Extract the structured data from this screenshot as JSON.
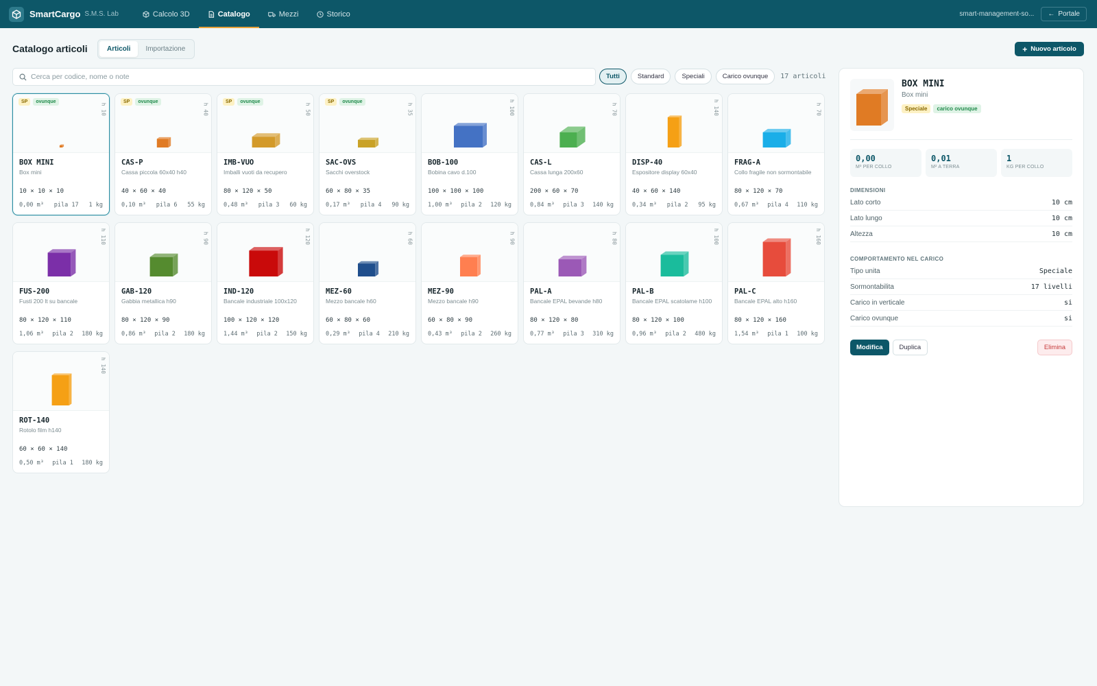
{
  "app": {
    "brand": "SmartCargo",
    "brand_sub": "S.M.S. Lab",
    "account": "smart-management-so...",
    "portal_label": "Portale",
    "accent": "#0d5768"
  },
  "nav": [
    {
      "label": "Calcolo 3D",
      "icon": "cube-icon"
    },
    {
      "label": "Catalogo",
      "icon": "document-icon",
      "active": true
    },
    {
      "label": "Mezzi",
      "icon": "truck-icon"
    },
    {
      "label": "Storico",
      "icon": "clock-icon"
    }
  ],
  "header": {
    "title": "Catalogo articoli",
    "tabs": [
      "Articoli",
      "Importazione"
    ],
    "new_button": "Nuovo articolo"
  },
  "search": {
    "placeholder": "Cerca per codice, nome o note"
  },
  "filters": {
    "chips": [
      "Tutti",
      "Standard",
      "Speciali",
      "Carico ovunque"
    ],
    "count": "17 articoli"
  },
  "tags": {
    "sp": "SP",
    "ov": "ovunque"
  },
  "items": [
    {
      "code": "BOX MINI",
      "name": "Box mini",
      "dims": "10 × 10 × 10",
      "vol": "0,00 m³",
      "pile": "pila 17",
      "weight": "1 kg",
      "h": "h 10",
      "sp": true,
      "color": "#e07b24",
      "hval": 10,
      "wval": 10,
      "lval": 10
    },
    {
      "code": "CAS-P",
      "name": "Cassa piccola 60x40 h40",
      "dims": "40 × 60 × 40",
      "vol": "0,10 m³",
      "pile": "pila 6",
      "weight": "55 kg",
      "h": "h 40",
      "sp": true,
      "color": "#e07b24",
      "hval": 40,
      "wval": 40,
      "lval": 60
    },
    {
      "code": "IMB-VUO",
      "name": "Imballi vuoti da recupero",
      "dims": "80 × 120 × 50",
      "vol": "0,48 m³",
      "pile": "pila 3",
      "weight": "60 kg",
      "h": "h 50",
      "sp": true,
      "color": "#d39a2a",
      "hval": 50,
      "wval": 80,
      "lval": 120
    },
    {
      "code": "SAC-OVS",
      "name": "Sacchi overstock",
      "dims": "60 × 80 × 35",
      "vol": "0,17 m³",
      "pile": "pila 4",
      "weight": "90 kg",
      "h": "h 35",
      "sp": true,
      "color": "#c9a227",
      "hval": 35,
      "wval": 60,
      "lval": 80
    },
    {
      "code": "BOB-100",
      "name": "Bobina cavo d.100",
      "dims": "100 × 100 × 100",
      "vol": "1,00 m³",
      "pile": "pila 2",
      "weight": "120 kg",
      "h": "h 100",
      "sp": false,
      "color": "#4472c4",
      "hval": 100,
      "wval": 100,
      "lval": 100
    },
    {
      "code": "CAS-L",
      "name": "Cassa lunga 200x60",
      "dims": "200 × 60 × 70",
      "vol": "0,84 m³",
      "pile": "pila 3",
      "weight": "140 kg",
      "h": "h 70",
      "sp": false,
      "color": "#4caf50",
      "hval": 70,
      "wval": 60,
      "lval": 200
    },
    {
      "code": "DISP-40",
      "name": "Espositore display 60x40",
      "dims": "40 × 60 × 140",
      "vol": "0,34 m³",
      "pile": "pila 2",
      "weight": "95 kg",
      "h": "h 140",
      "sp": false,
      "color": "#f5a015",
      "hval": 140,
      "wval": 40,
      "lval": 60
    },
    {
      "code": "FRAG-A",
      "name": "Collo fragile non sormontabile",
      "dims": "80 × 120 × 70",
      "vol": "0,67 m³",
      "pile": "pila 4",
      "weight": "110 kg",
      "h": "h 70",
      "sp": false,
      "color": "#1aaee8",
      "hval": 70,
      "wval": 80,
      "lval": 120
    },
    {
      "code": "FUS-200",
      "name": "Fusti 200 lt su bancale",
      "dims": "80 × 120 × 110",
      "vol": "1,06 m³",
      "pile": "pila 2",
      "weight": "180 kg",
      "h": "h 110",
      "sp": false,
      "color": "#7b2fa8",
      "hval": 110,
      "wval": 80,
      "lval": 120
    },
    {
      "code": "GAB-120",
      "name": "Gabbia metallica h90",
      "dims": "80 × 120 × 90",
      "vol": "0,86 m³",
      "pile": "pila 2",
      "weight": "180 kg",
      "h": "h 90",
      "sp": false,
      "color": "#558b2f",
      "hval": 90,
      "wval": 80,
      "lval": 120
    },
    {
      "code": "IND-120",
      "name": "Bancale industriale 100x120",
      "dims": "100 × 120 × 120",
      "vol": "1,44 m³",
      "pile": "pila 2",
      "weight": "150 kg",
      "h": "h 120",
      "sp": false,
      "color": "#c90a0a",
      "hval": 120,
      "wval": 100,
      "lval": 120
    },
    {
      "code": "MEZ-60",
      "name": "Mezzo bancale h60",
      "dims": "60 × 80 × 60",
      "vol": "0,29 m³",
      "pile": "pila 4",
      "weight": "210 kg",
      "h": "h 60",
      "sp": false,
      "color": "#1f4e8c",
      "hval": 60,
      "wval": 60,
      "lval": 80
    },
    {
      "code": "MEZ-90",
      "name": "Mezzo bancale h90",
      "dims": "60 × 80 × 90",
      "vol": "0,43 m³",
      "pile": "pila 2",
      "weight": "260 kg",
      "h": "h 90",
      "sp": false,
      "color": "#ff7f50",
      "hval": 90,
      "wval": 60,
      "lval": 80
    },
    {
      "code": "PAL-A",
      "name": "Bancale EPAL bevande h80",
      "dims": "80 × 120 × 80",
      "vol": "0,77 m³",
      "pile": "pila 3",
      "weight": "310 kg",
      "h": "h 80",
      "sp": false,
      "color": "#9b59b6",
      "hval": 80,
      "wval": 80,
      "lval": 120
    },
    {
      "code": "PAL-B",
      "name": "Bancale EPAL scatolame h100",
      "dims": "80 × 120 × 100",
      "vol": "0,96 m³",
      "pile": "pila 2",
      "weight": "480 kg",
      "h": "h 100",
      "sp": false,
      "color": "#1abc9c",
      "hval": 100,
      "wval": 80,
      "lval": 120
    },
    {
      "code": "PAL-C",
      "name": "Bancale EPAL alto h160",
      "dims": "80 × 120 × 160",
      "vol": "1,54 m³",
      "pile": "pila 1",
      "weight": "100 kg",
      "h": "h 160",
      "sp": false,
      "color": "#e74c3c",
      "hval": 160,
      "wval": 80,
      "lval": 120
    },
    {
      "code": "ROT-140",
      "name": "Rotolo film h140",
      "dims": "60 × 60 × 140",
      "vol": "0,50 m³",
      "pile": "pila 1",
      "weight": "180 kg",
      "h": "h 140",
      "sp": false,
      "color": "#f5a015",
      "hval": 140,
      "wval": 60,
      "lval": 60
    }
  ],
  "detail": {
    "title": "BOX MINI",
    "subtitle": "Box mini",
    "tags": [
      "Speciale",
      "carico ovunque"
    ],
    "color": "#e07b24",
    "stats": [
      {
        "value": "0,00",
        "label": "M³ PER COLLO"
      },
      {
        "value": "0,01",
        "label": "M² A TERRA"
      },
      {
        "value": "1",
        "label": "KG PER COLLO"
      }
    ],
    "dims_header": "DIMENSIONI",
    "dims": [
      {
        "k": "Lato corto",
        "v": "10 cm"
      },
      {
        "k": "Lato lungo",
        "v": "10 cm"
      },
      {
        "k": "Altezza",
        "v": "10 cm"
      }
    ],
    "behavior_header": "COMPORTAMENTO NEL CARICO",
    "behavior": [
      {
        "k": "Tipo unita",
        "v": "Speciale"
      },
      {
        "k": "Sormontabilita",
        "v": "17 livelli"
      },
      {
        "k": "Carico in verticale",
        "v": "si"
      },
      {
        "k": "Carico ovunque",
        "v": "si"
      }
    ],
    "actions": {
      "edit": "Modifica",
      "duplicate": "Duplica",
      "delete": "Elimina"
    }
  }
}
